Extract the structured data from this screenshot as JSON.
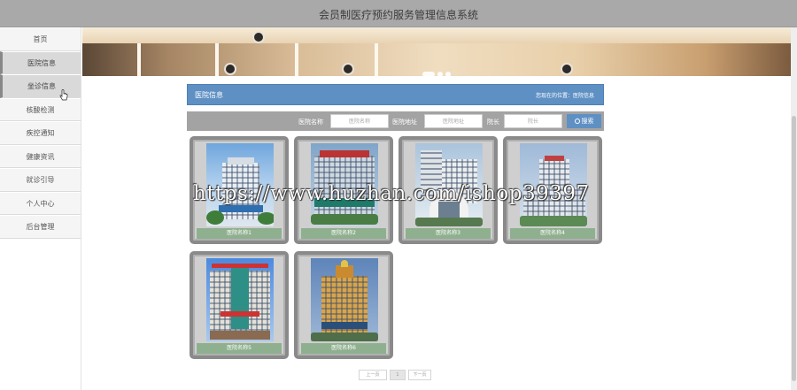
{
  "header": {
    "title": "会员制医疗预约服务管理信息系统"
  },
  "sidebar": {
    "items": [
      {
        "label": "首页"
      },
      {
        "label": "医院信息"
      },
      {
        "label": "坐诊信息"
      },
      {
        "label": "核酸检测"
      },
      {
        "label": "疾控通知"
      },
      {
        "label": "健康资讯"
      },
      {
        "label": "就诊引导"
      },
      {
        "label": "个人中心"
      },
      {
        "label": "后台管理"
      }
    ]
  },
  "section": {
    "title": "医院信息",
    "breadcrumb": "您现在的位置：医院信息"
  },
  "search": {
    "fields": [
      {
        "label": "医院名称",
        "placeholder": "医院名称"
      },
      {
        "label": "医院地址",
        "placeholder": "医院地址"
      },
      {
        "label": "院长",
        "placeholder": "院长"
      }
    ],
    "button_label": "搜索"
  },
  "cards": [
    {
      "caption": "医院名称1"
    },
    {
      "caption": "医院名称2"
    },
    {
      "caption": "医院名称3"
    },
    {
      "caption": "医院名称4"
    },
    {
      "caption": "医院名称5"
    },
    {
      "caption": "医院名称6"
    }
  ],
  "watermark": "https://www.huzhan.com/ishop39397",
  "pagination": {
    "prev": "上一页",
    "current": "1",
    "next": "下一页"
  },
  "colors": {
    "accent": "#5f90c4",
    "topbar": "#a9a9a9",
    "caption": "#8fb08f"
  }
}
